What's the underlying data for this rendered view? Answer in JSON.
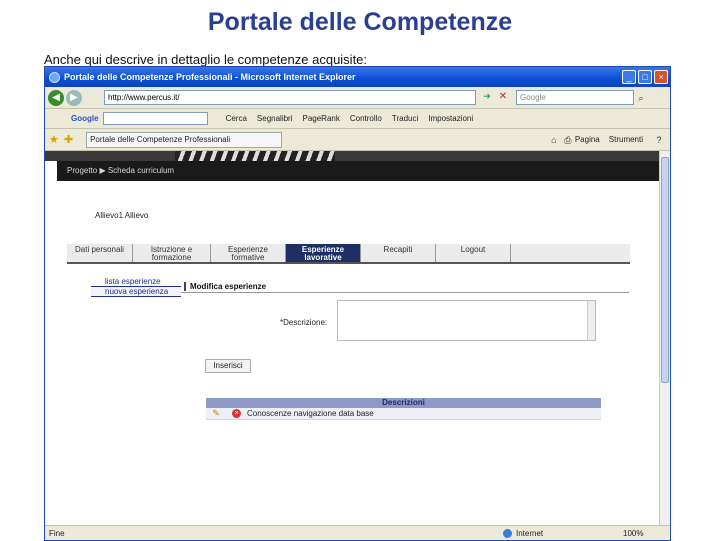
{
  "slide": {
    "title": "Portale delle Competenze",
    "caption": "Anche qui descrive in dettaglio le competenze acquisite:"
  },
  "window": {
    "title": "Portale delle Competenze Professionali - Microsoft Internet Explorer",
    "address": "http://www.percus.it/",
    "search_placeholder": "Google"
  },
  "googlebar": {
    "brand": "Google",
    "items": [
      "Cerca",
      "Segnalibri",
      "PageRank",
      "Controllo",
      "Traduci",
      "Impostazioni"
    ]
  },
  "favbar": {
    "tab_title": "Portale delle Competenze Professionali",
    "items": [
      "Pagina",
      "Strumenti"
    ]
  },
  "page": {
    "breadcrumb": "Progetto ▶ Scheda curriculum",
    "user_name": "Allievo1 Allievo",
    "tabs": [
      {
        "label": "Dati personali"
      },
      {
        "label": "Istruzione e formazione"
      },
      {
        "label": "Esperienze formative"
      },
      {
        "label": "Esperienze lavorative"
      },
      {
        "label": "Recapiti"
      },
      {
        "label": "Logout"
      }
    ],
    "subnav": [
      "lista esperienze",
      "nuova esperienza"
    ],
    "section_title": "Modifica esperienze",
    "description_label": "*Descrizione:",
    "insert_button": "Inserisci",
    "table": {
      "header": "Descrizioni",
      "rows": [
        "Conoscenze navigazione data base"
      ]
    }
  },
  "status": {
    "left": "Fine",
    "zone": "Internet",
    "zoom": "100%"
  }
}
